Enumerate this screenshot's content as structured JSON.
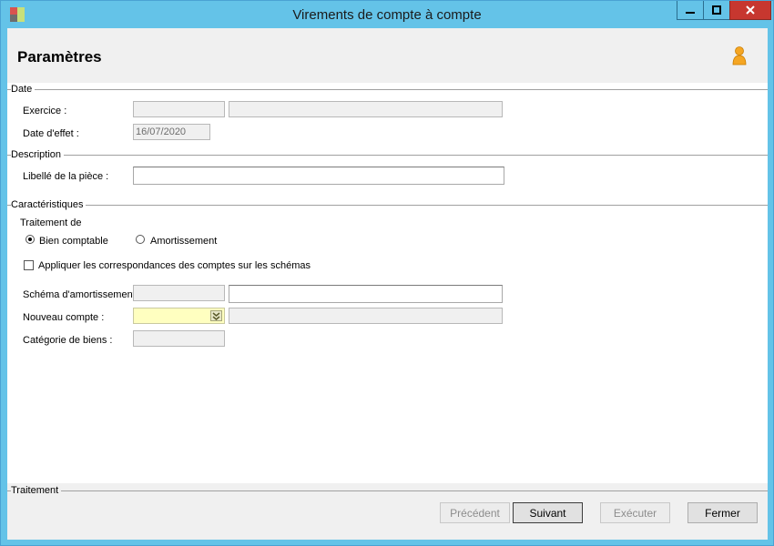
{
  "window": {
    "title": "Virements de compte à compte",
    "minimize_icon": "minimize-icon",
    "maximize_icon": "maximize-icon",
    "close_icon": "close-icon"
  },
  "header": {
    "title": "Paramètres",
    "user_icon": "user-icon"
  },
  "groups": {
    "date": "Date",
    "description": "Description",
    "caracteristiques": "Caractéristiques",
    "traitement": "Traitement"
  },
  "date": {
    "exercice_label": "Exercice :",
    "exercice_code": "",
    "exercice_desc": "",
    "date_effet_label": "Date d'effet :",
    "date_effet_value": "16/07/2020"
  },
  "description": {
    "libelle_label": "Libellé de la pièce :",
    "libelle_value": ""
  },
  "caracteristiques": {
    "traitement_de_label": "Traitement de",
    "radio_bien": "Bien comptable",
    "radio_amort": "Amortissement",
    "selected": "Bien comptable",
    "checkbox_label": "Appliquer les correspondances des comptes sur les schémas",
    "checkbox_checked": false,
    "schema_label": "Schéma d'amortissement",
    "schema_code": "",
    "schema_desc": "",
    "nouveau_compte_label": "Nouveau compte :",
    "nouveau_compte_value": "",
    "nouveau_compte_desc": "",
    "categorie_label": "Catégorie de biens :",
    "categorie_value": ""
  },
  "buttons": {
    "precedent": "Précédent",
    "suivant": "Suivant",
    "executer": "Exécuter",
    "fermer": "Fermer"
  },
  "colors": {
    "titlebar": "#64c3e8",
    "close_button": "#c7372f",
    "required_field": "#ffffc0"
  }
}
